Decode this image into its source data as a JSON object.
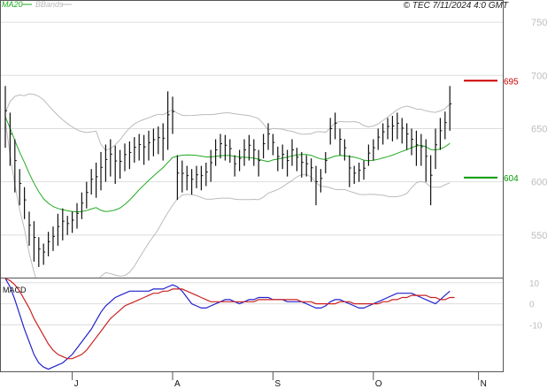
{
  "header": {
    "copyright": "© TEC 7/11/2024 4:0 GMT",
    "legend_ma": "MA20",
    "legend_bb": "BBands"
  },
  "colors": {
    "price_bars": "#111111",
    "ma20": "#22aa22",
    "bbands": "#bbbbbb",
    "resistance": "#cc0000",
    "support": "#009900",
    "macd_line": "#2222cc",
    "macd_signal": "#cc2222",
    "grid": "#dddddd"
  },
  "chart_data": [
    {
      "type": "ohlc",
      "panel": "price",
      "yticks": [
        550,
        600,
        650,
        700,
        750
      ],
      "ylim": [
        510,
        770
      ],
      "xlabels": [
        {
          "label": "J",
          "i": 14
        },
        {
          "label": "A",
          "i": 35
        },
        {
          "label": "S",
          "i": 56
        },
        {
          "label": "O",
          "i": 77
        },
        {
          "label": "N",
          "i": 99
        }
      ],
      "levels": [
        {
          "name": "resistance",
          "value": 695,
          "label": "695"
        },
        {
          "name": "support",
          "value": 604,
          "label": "604"
        }
      ],
      "bars": [
        [
          690,
          632
        ],
        [
          665,
          615
        ],
        [
          640,
          590
        ],
        [
          612,
          578
        ],
        [
          595,
          565
        ],
        [
          572,
          540
        ],
        [
          563,
          525
        ],
        [
          548,
          520
        ],
        [
          542,
          522
        ],
        [
          553,
          530
        ],
        [
          558,
          535
        ],
        [
          570,
          540
        ],
        [
          575,
          545
        ],
        [
          568,
          550
        ],
        [
          572,
          552
        ],
        [
          580,
          556
        ],
        [
          590,
          565
        ],
        [
          600,
          575
        ],
        [
          612,
          588
        ],
        [
          618,
          585
        ],
        [
          628,
          592
        ],
        [
          635,
          600
        ],
        [
          640,
          605
        ],
        [
          634,
          598
        ],
        [
          630,
          603
        ],
        [
          636,
          610
        ],
        [
          638,
          612
        ],
        [
          642,
          618
        ],
        [
          645,
          620
        ],
        [
          644,
          616
        ],
        [
          648,
          620
        ],
        [
          650,
          624
        ],
        [
          652,
          626
        ],
        [
          655,
          620
        ],
        [
          685,
          630
        ],
        [
          680,
          645
        ],
        [
          625,
          583
        ],
        [
          620,
          590
        ],
        [
          615,
          592
        ],
        [
          612,
          588
        ],
        [
          615,
          594
        ],
        [
          615,
          592
        ],
        [
          618,
          596
        ],
        [
          630,
          600
        ],
        [
          640,
          615
        ],
        [
          645,
          622
        ],
        [
          644,
          620
        ],
        [
          640,
          618
        ],
        [
          625,
          605
        ],
        [
          630,
          610
        ],
        [
          640,
          615
        ],
        [
          644,
          620
        ],
        [
          640,
          615
        ],
        [
          630,
          605
        ],
        [
          645,
          622
        ],
        [
          655,
          630
        ],
        [
          645,
          625
        ],
        [
          633,
          610
        ],
        [
          635,
          612
        ],
        [
          630,
          605
        ],
        [
          640,
          615
        ],
        [
          632,
          610
        ],
        [
          628,
          604
        ],
        [
          625,
          605
        ],
        [
          622,
          600
        ],
        [
          615,
          578
        ],
        [
          612,
          590
        ],
        [
          628,
          608
        ],
        [
          660,
          635
        ],
        [
          665,
          640
        ],
        [
          650,
          625
        ],
        [
          640,
          620
        ],
        [
          625,
          595
        ],
        [
          615,
          598
        ],
        [
          618,
          600
        ],
        [
          620,
          602
        ],
        [
          635,
          615
        ],
        [
          640,
          620
        ],
        [
          650,
          630
        ],
        [
          655,
          635
        ],
        [
          660,
          640
        ],
        [
          662,
          638
        ],
        [
          665,
          640
        ],
        [
          660,
          636
        ],
        [
          655,
          630
        ],
        [
          650,
          625
        ],
        [
          648,
          615
        ],
        [
          645,
          615
        ],
        [
          640,
          600
        ],
        [
          625,
          578
        ],
        [
          650,
          612
        ],
        [
          660,
          630
        ],
        [
          666,
          640
        ],
        [
          690,
          648
        ]
      ]
    },
    {
      "type": "line",
      "panel": "macd",
      "title": "MACD",
      "yticks": [
        10,
        0,
        -10
      ],
      "ylim": [
        -32,
        12
      ],
      "series": [
        {
          "role": "macd",
          "values": [
            12,
            8,
            2,
            -5,
            -12,
            -18,
            -24,
            -28,
            -30,
            -31,
            -30,
            -29,
            -28,
            -26,
            -24,
            -21,
            -18,
            -15,
            -12,
            -8,
            -4,
            -1,
            1,
            3,
            4,
            5,
            6,
            6,
            6,
            6,
            6,
            7,
            7,
            7,
            8,
            9,
            8,
            6,
            3,
            0,
            -1,
            -2,
            -2,
            -1,
            0,
            1,
            2,
            2,
            1,
            0,
            1,
            2,
            2,
            3,
            3,
            3,
            2,
            2,
            2,
            1,
            1,
            1,
            1,
            0,
            -1,
            -2,
            -2,
            -1,
            1,
            2,
            2,
            1,
            0,
            -1,
            -2,
            -2,
            -1,
            0,
            1,
            2,
            3,
            4,
            5,
            5,
            5,
            5,
            4,
            3,
            2,
            1,
            0,
            2,
            4,
            6
          ]
        },
        {
          "role": "signal",
          "values": [
            12,
            11,
            9,
            6,
            2,
            -2,
            -7,
            -11,
            -15,
            -19,
            -22,
            -24,
            -25,
            -26,
            -26,
            -25,
            -24,
            -22,
            -19,
            -16,
            -13,
            -10,
            -7,
            -5,
            -3,
            -1,
            0,
            1,
            2,
            3,
            4,
            5,
            5,
            6,
            6,
            7,
            7,
            7,
            6,
            5,
            4,
            3,
            2,
            1,
            1,
            1,
            1,
            1,
            1,
            1,
            1,
            1,
            1,
            2,
            2,
            2,
            2,
            2,
            2,
            2,
            2,
            2,
            1,
            1,
            1,
            0,
            0,
            0,
            0,
            0,
            1,
            1,
            1,
            0,
            0,
            0,
            0,
            0,
            0,
            1,
            1,
            2,
            2,
            3,
            3,
            4,
            4,
            4,
            4,
            3,
            3,
            2,
            2,
            3,
            3
          ]
        }
      ]
    }
  ]
}
